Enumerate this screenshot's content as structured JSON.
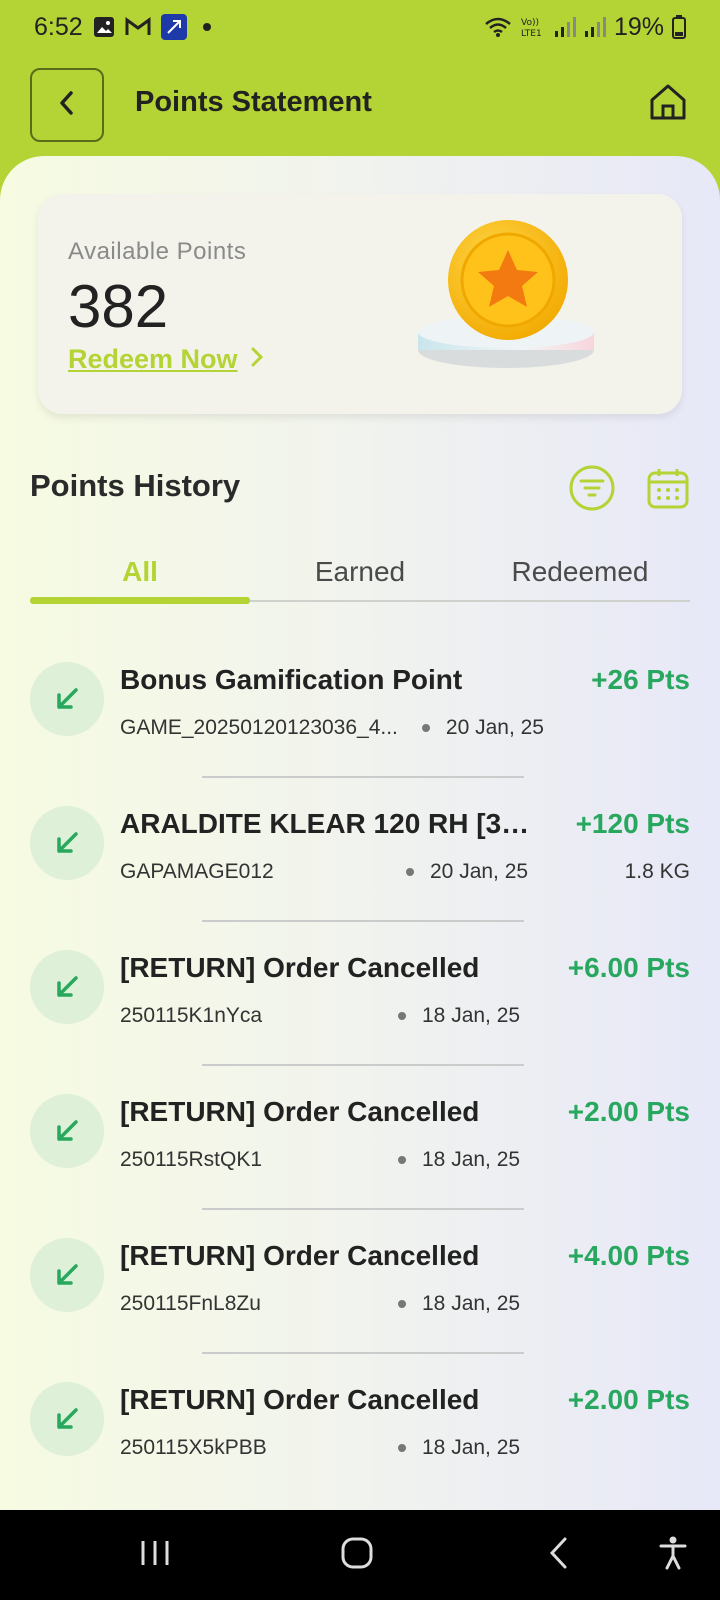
{
  "status_bar": {
    "time": "6:52",
    "battery": "19%"
  },
  "header": {
    "title": "Points Statement"
  },
  "points_card": {
    "label": "Available Points",
    "value": "382",
    "redeem_label": "Redeem Now"
  },
  "history": {
    "title": "Points History"
  },
  "tabs": [
    {
      "label": "All",
      "active": true
    },
    {
      "label": "Earned",
      "active": false
    },
    {
      "label": "Redeemed",
      "active": false
    }
  ],
  "items": [
    {
      "title": "Bonus Gamification Point",
      "points": "+26 Pts",
      "code": "GAME_20250120123036_4...",
      "date": "20 Jan, 25",
      "extra": ""
    },
    {
      "title": "ARALDITE KLEAR 120 RH [3X...",
      "points": "+120 Pts",
      "code": "GAPAMAGE012",
      "date": "20 Jan, 25",
      "extra": "1.8 KG"
    },
    {
      "title": "[RETURN] Order Cancelled",
      "points": "+6.00 Pts",
      "code": "250115K1nYca",
      "date": "18 Jan, 25",
      "extra": ""
    },
    {
      "title": "[RETURN] Order Cancelled",
      "points": "+2.00 Pts",
      "code": "250115RstQK1",
      "date": "18 Jan, 25",
      "extra": ""
    },
    {
      "title": "[RETURN] Order Cancelled",
      "points": "+4.00 Pts",
      "code": "250115FnL8Zu",
      "date": "18 Jan, 25",
      "extra": ""
    },
    {
      "title": "[RETURN] Order Cancelled",
      "points": "+2.00 Pts",
      "code": "250115X5kPBB",
      "date": "18 Jan, 25",
      "extra": ""
    }
  ],
  "colors": {
    "brand": "#b4d334",
    "earned": "#27a85e"
  }
}
